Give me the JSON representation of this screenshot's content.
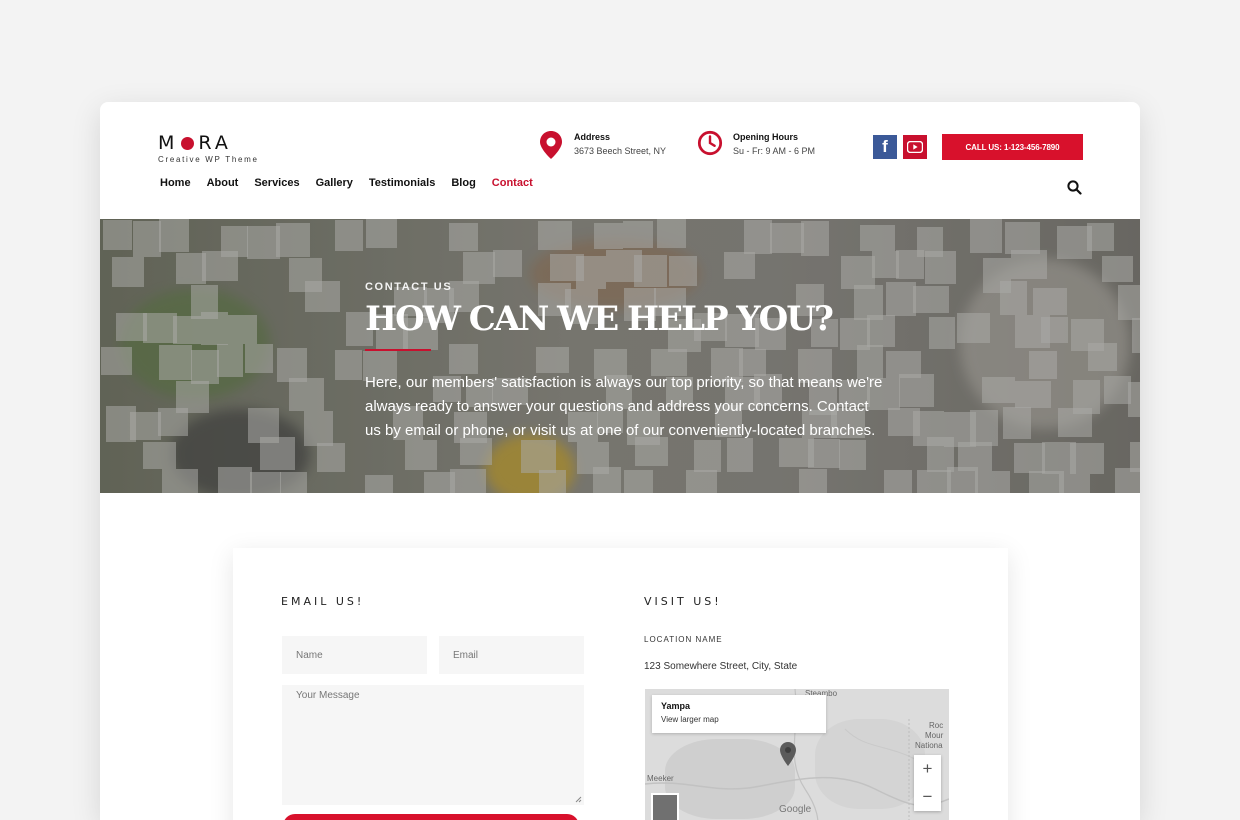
{
  "brand": {
    "name_start": "M",
    "name_end": "RA",
    "tagline": "Creative WP Theme",
    "accent": "#c8102e"
  },
  "header": {
    "address": {
      "title": "Address",
      "value": "3673 Beech Street, NY",
      "icon": "map-pin-icon"
    },
    "hours": {
      "title": "Opening Hours",
      "value": "Su - Fr: 9 AM - 6 PM",
      "icon": "clock-icon"
    },
    "social": [
      {
        "icon": "facebook-icon",
        "glyph": "f"
      },
      {
        "icon": "youtube-icon"
      }
    ],
    "call_label": "CALL US: 1-123-456-7890"
  },
  "nav": {
    "items": [
      {
        "label": "Home",
        "active": false
      },
      {
        "label": "About",
        "active": false
      },
      {
        "label": "Services",
        "active": false
      },
      {
        "label": "Gallery",
        "active": false
      },
      {
        "label": "Testimonials",
        "active": false
      },
      {
        "label": "Blog",
        "active": false
      },
      {
        "label": "Contact",
        "active": true
      }
    ],
    "search_icon": "search-icon"
  },
  "hero": {
    "kicker": "CONTACT US",
    "title": "HOW CAN WE HELP YOU?",
    "text": "Here, our members' satisfaction is always our top priority, so that means we're always ready to answer your questions and address your concerns. Contact us by email or phone, or visit us at one of our conveniently-located branches."
  },
  "contact": {
    "email_title": "EMAIL US!",
    "name_placeholder": "Name",
    "email_placeholder": "Email",
    "message_placeholder": "Your Message",
    "visit_title": "VISIT US!",
    "location_label": "LOCATION NAME",
    "location_address": "123 Somewhere Street, City, State"
  },
  "map": {
    "place": "Yampa",
    "larger_link": "View larger map",
    "zoom_in": "+",
    "zoom_out": "−",
    "attribution": "Google",
    "labels": {
      "steamboat": "Steambo",
      "meeker": "Meeker",
      "roc": "Roc",
      "mour": "Mour",
      "nationa": "Nationa"
    }
  }
}
